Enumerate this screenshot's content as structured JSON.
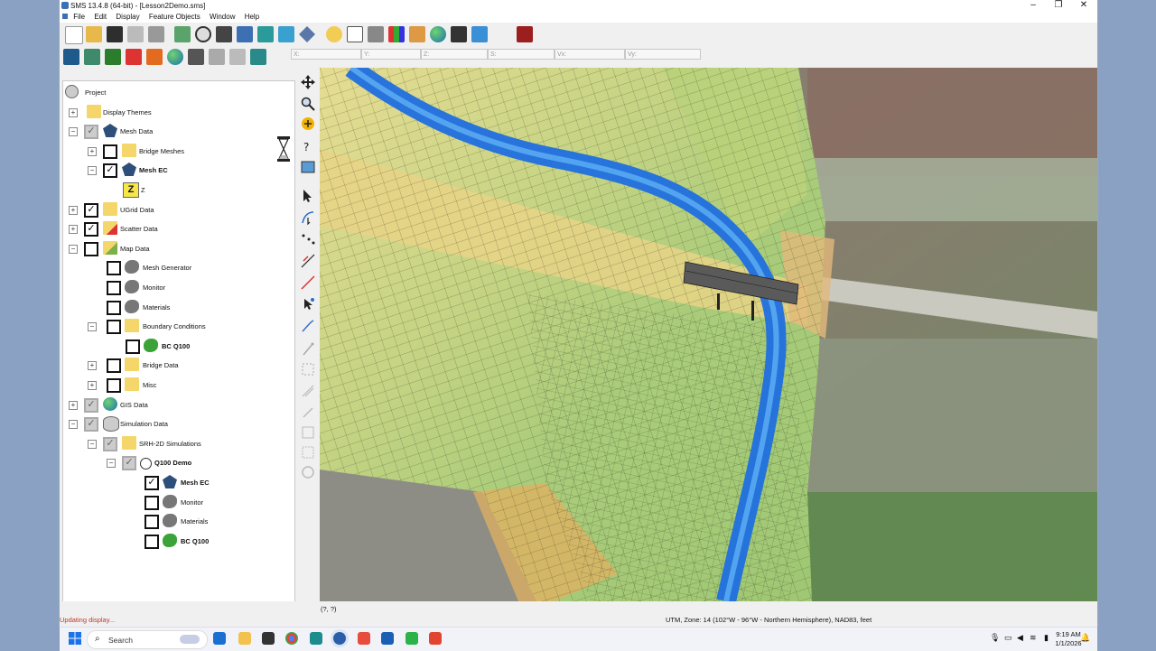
{
  "window": {
    "title": "SMS 13.4.8 (64-bit) - [Lesson2Demo.sms]",
    "controls": {
      "minimize": "–",
      "restore": "❐",
      "close": "✕"
    }
  },
  "menu": [
    "File",
    "Edit",
    "Display",
    "Feature Objects",
    "Window",
    "Help"
  ],
  "coords": {
    "x": "X:",
    "y": "Y:",
    "z": "Z:",
    "s": "S:",
    "vx": "Vx:",
    "vy": "Vy:"
  },
  "tree": {
    "project": "Project",
    "display_themes": "Display Themes",
    "mesh_data": "Mesh Data",
    "bridge_meshes": "Bridge Meshes",
    "mesh_ec": "Mesh EC",
    "z": "Z",
    "ugrid_data": "UGrid Data",
    "scatter_data": "Scatter Data",
    "map_data": "Map Data",
    "mesh_generator": "Mesh Generator",
    "monitor": "Monitor",
    "materials": "Materials",
    "boundary_conditions": "Boundary Conditions",
    "bc_q100": "BC Q100",
    "bridge_data": "Bridge Data",
    "misc": "Misc",
    "gis_data": "GIS Data",
    "simulation_data": "Simulation Data",
    "srh_sims": "SRH-2D Simulations",
    "q100_demo": "Q100 Demo",
    "sim_mesh_ec": "Mesh EC",
    "sim_monitor": "Monitor",
    "sim_materials": "Materials",
    "sim_bc_q100": "BC Q100"
  },
  "status": {
    "left": "Updating display...",
    "cursor": "(?, ?)",
    "projection": "UTM, Zone: 14 (102°W - 96°W - Northern Hemisphere), NAD83, feet"
  },
  "taskbar": {
    "search_placeholder": "Search",
    "time": "9:19 AM",
    "date": "1/1/2026"
  },
  "icons": {
    "busy": "hourglass-icon",
    "start": "windows-start-icon"
  },
  "colors": {
    "river": "#1f6fe0",
    "terrain_green": "#a7c96a",
    "terrain_yellow": "#e8d98a",
    "accent_status": "#c0392b"
  }
}
